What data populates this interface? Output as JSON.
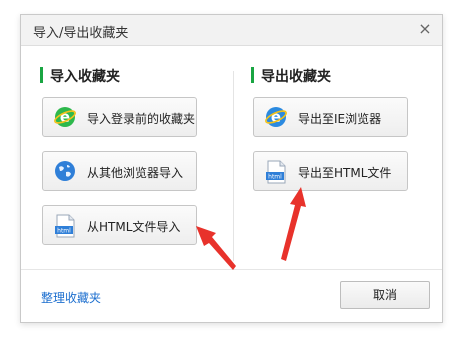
{
  "dialog": {
    "title": "导入/导出收藏夹",
    "close_glyph": "×"
  },
  "import": {
    "heading": "导入收藏夹",
    "buttons": [
      {
        "label": "导入登录前的收藏夹",
        "icon": "ie-green-e-icon"
      },
      {
        "label": "从其他浏览器导入",
        "icon": "globe-icon"
      },
      {
        "label": "从HTML文件导入",
        "icon": "html-file-icon"
      }
    ]
  },
  "export": {
    "heading": "导出收藏夹",
    "buttons": [
      {
        "label": "导出至IE浏览器",
        "icon": "ie-blue-e-icon"
      },
      {
        "label": "导出至HTML文件",
        "icon": "html-file-icon"
      }
    ]
  },
  "footer": {
    "link": "整理收藏夹",
    "cancel": "取消"
  },
  "html_icon_text": "html",
  "colors": {
    "accent_green": "#19a542",
    "link_blue": "#1d6fcf",
    "annotation_red": "#e8322b"
  }
}
